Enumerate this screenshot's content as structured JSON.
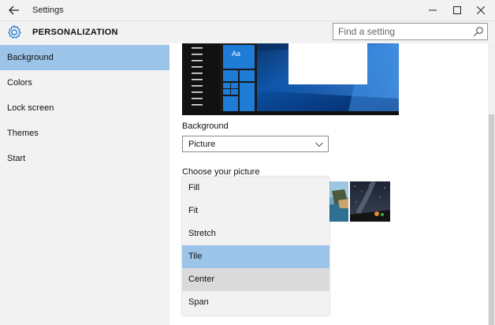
{
  "window": {
    "title": "Settings",
    "controls": {
      "minimize": "—",
      "maximize": "☐",
      "close": "✕"
    }
  },
  "header": {
    "app_title": "PERSONALIZATION",
    "search_placeholder": "Find a setting"
  },
  "sidebar": {
    "items": [
      {
        "label": "Background",
        "active": true
      },
      {
        "label": "Colors"
      },
      {
        "label": "Lock screen"
      },
      {
        "label": "Themes"
      },
      {
        "label": "Start"
      }
    ]
  },
  "preview": {
    "tile_label": "Aa"
  },
  "main": {
    "background_label": "Background",
    "background_value": "Picture",
    "choose_picture_label": "Choose your picture"
  },
  "fit_dropdown": {
    "options": [
      "Fill",
      "Fit",
      "Stretch",
      "Tile",
      "Center",
      "Span"
    ],
    "selected": "Tile",
    "hovered": "Center"
  },
  "colors": {
    "accent_selected": "#9cc4e8",
    "tile_blue": "#1e7bd6",
    "chrome": "#f2f2f2"
  }
}
